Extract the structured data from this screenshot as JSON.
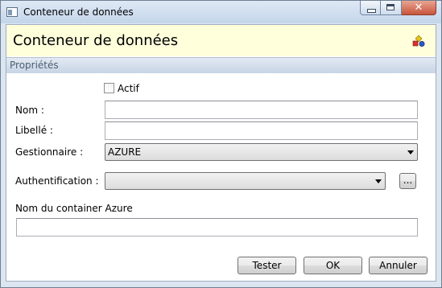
{
  "window": {
    "title": "Conteneur de données",
    "controls": {
      "minimize": "minimize-icon",
      "maximize": "maximize-icon",
      "close": "close-icon",
      "close_glyph": "✕"
    }
  },
  "header": {
    "title": "Conteneur de données",
    "icon": "database-shapes-icon"
  },
  "section": {
    "label": "Propriétés"
  },
  "form": {
    "actif": {
      "label": "Actif",
      "checked": false
    },
    "nom": {
      "label": "Nom :",
      "value": ""
    },
    "libelle": {
      "label": "Libellé :",
      "value": ""
    },
    "gestionnaire": {
      "label": "Gestionnaire :",
      "value": "AZURE"
    },
    "authentification": {
      "label": "Authentification :",
      "value": "",
      "browse_label": "..."
    },
    "container": {
      "label": "Nom du container Azure",
      "value": ""
    }
  },
  "buttons": {
    "test": "Tester",
    "ok": "OK",
    "cancel": "Annuler"
  },
  "colors": {
    "header_bg": "#ffffdc",
    "section_bg": "#c7d4e4",
    "close_red": "#c8553c"
  }
}
